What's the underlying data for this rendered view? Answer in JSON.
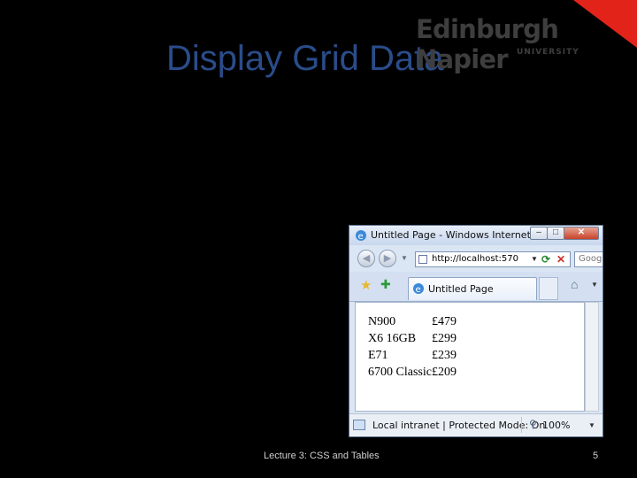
{
  "slide": {
    "title": "Display Grid Data",
    "footer": "Lecture 3: CSS and Tables",
    "page_number": "5"
  },
  "logo": {
    "name": "Edinburgh Napier",
    "sub": "UNIVERSITY",
    "accent_color": "#e2231a"
  },
  "browser": {
    "window_title": "Untitled Page - Windows Internet Ex...",
    "address": "http://localhost:570",
    "search_placeholder": "Goog",
    "tab_label": "Untitled Page",
    "status_text": "Local intranet | Protected Mode: On",
    "zoom": "100%",
    "grid_rows": [
      {
        "name": "N900",
        "price": "£479"
      },
      {
        "name": "X6 16GB",
        "price": "£299"
      },
      {
        "name": "E71",
        "price": "£239"
      },
      {
        "name": "6700 Classic",
        "price": "£209"
      }
    ]
  },
  "colors": {
    "background": "#000000",
    "title": "#2a4c8a",
    "browser_chrome": "#dbe6f4"
  }
}
